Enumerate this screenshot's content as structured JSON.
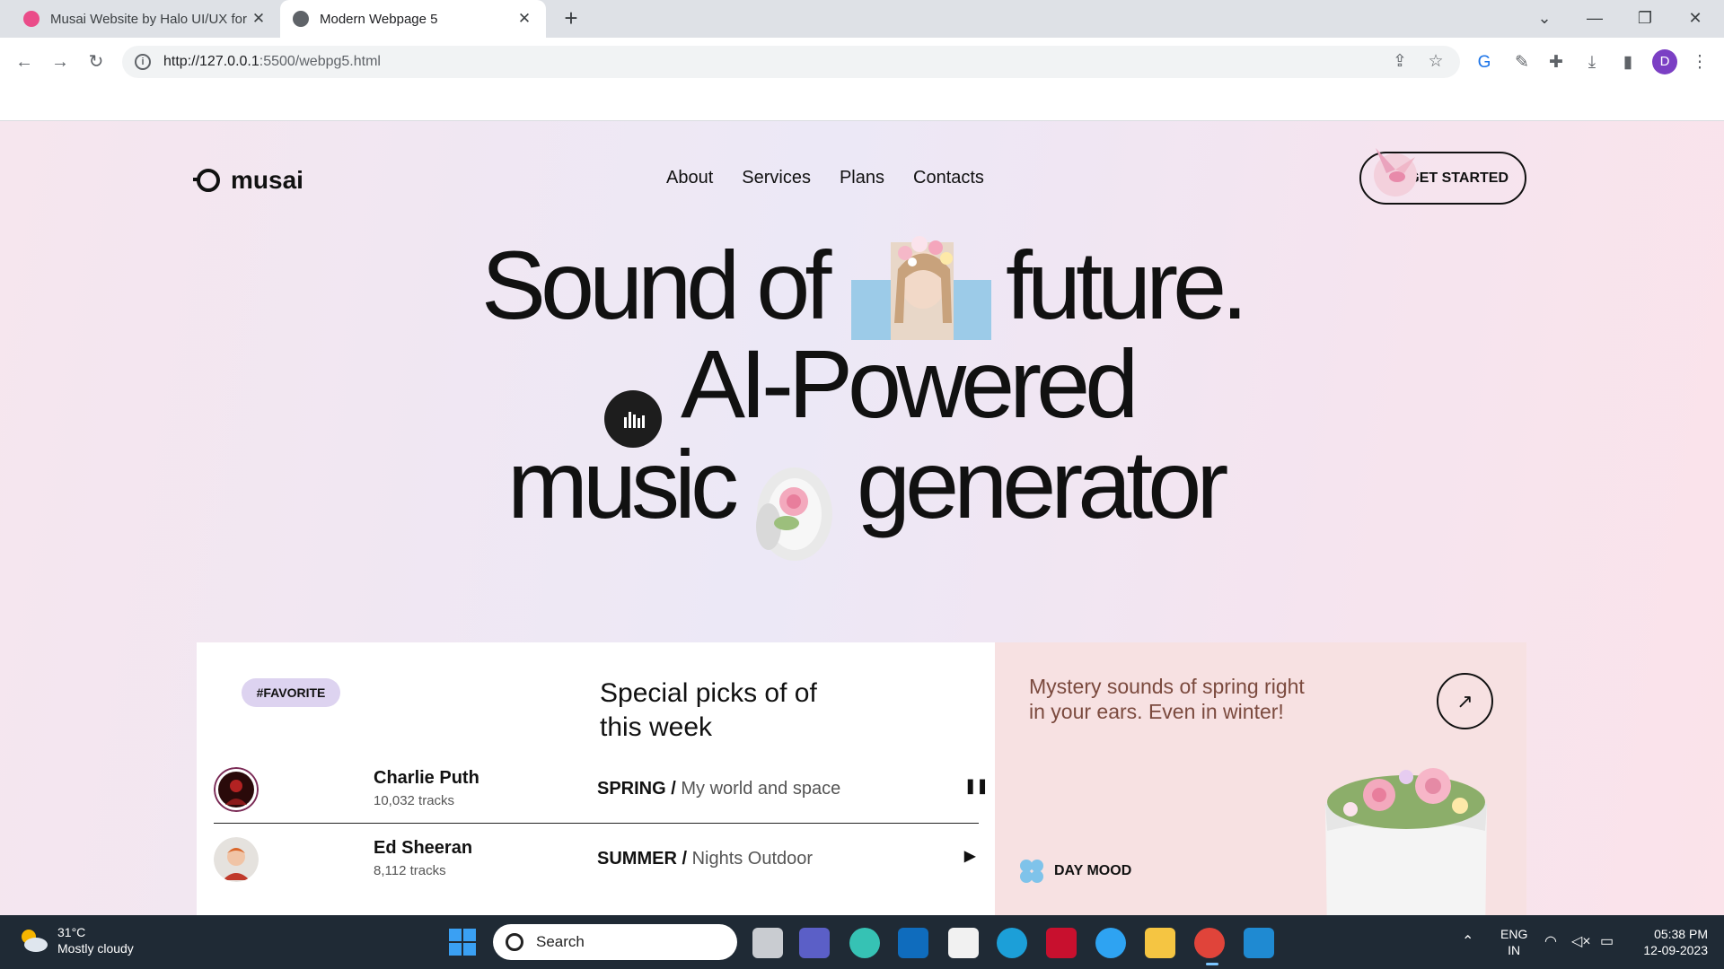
{
  "browser": {
    "tabs": [
      {
        "title": "Musai Website by Halo UI/UX for",
        "active": false
      },
      {
        "title": "Modern Webpage 5",
        "active": true
      }
    ],
    "url": {
      "host": "http://127.0.0.1",
      "path": ":5500/webpg5.html"
    },
    "profile_initial": "D"
  },
  "site": {
    "logo": "musai",
    "nav": [
      "About",
      "Services",
      "Plans",
      "Contacts"
    ],
    "cta": "GET STARTED",
    "hero": {
      "line1a": "Sound of",
      "line1b": "future.",
      "line2": "AI-Powered",
      "line3a": "music",
      "line3b": "generator"
    },
    "favorite_badge": "#FAVORITE",
    "picks_title": "Special picks of of this week",
    "tracks": [
      {
        "artist": "Charlie Puth",
        "count": "10,032 tracks",
        "season": "SPRING /",
        "title": "My world and space",
        "control": "pause"
      },
      {
        "artist": "Ed Sheeran",
        "count": "8,112 tracks",
        "season": "SUMMER /",
        "title": "Nights Outdoor",
        "control": "play"
      }
    ],
    "promo": {
      "text": "Mystery sounds of spring right in your ears. Even in winter!",
      "mood": "DAY MOOD"
    }
  },
  "taskbar": {
    "weather_temp": "31°C",
    "weather_desc": "Mostly cloudy",
    "search_placeholder": "Search",
    "lang1": "ENG",
    "lang2": "IN",
    "time": "05:38 PM",
    "date": "12-09-2023"
  },
  "colors": {
    "accent_badge": "#ddd3f0",
    "promo_bg": "#f7e1e2",
    "promo_text": "#7b4a3e",
    "taskbar": "#1f2a35"
  }
}
